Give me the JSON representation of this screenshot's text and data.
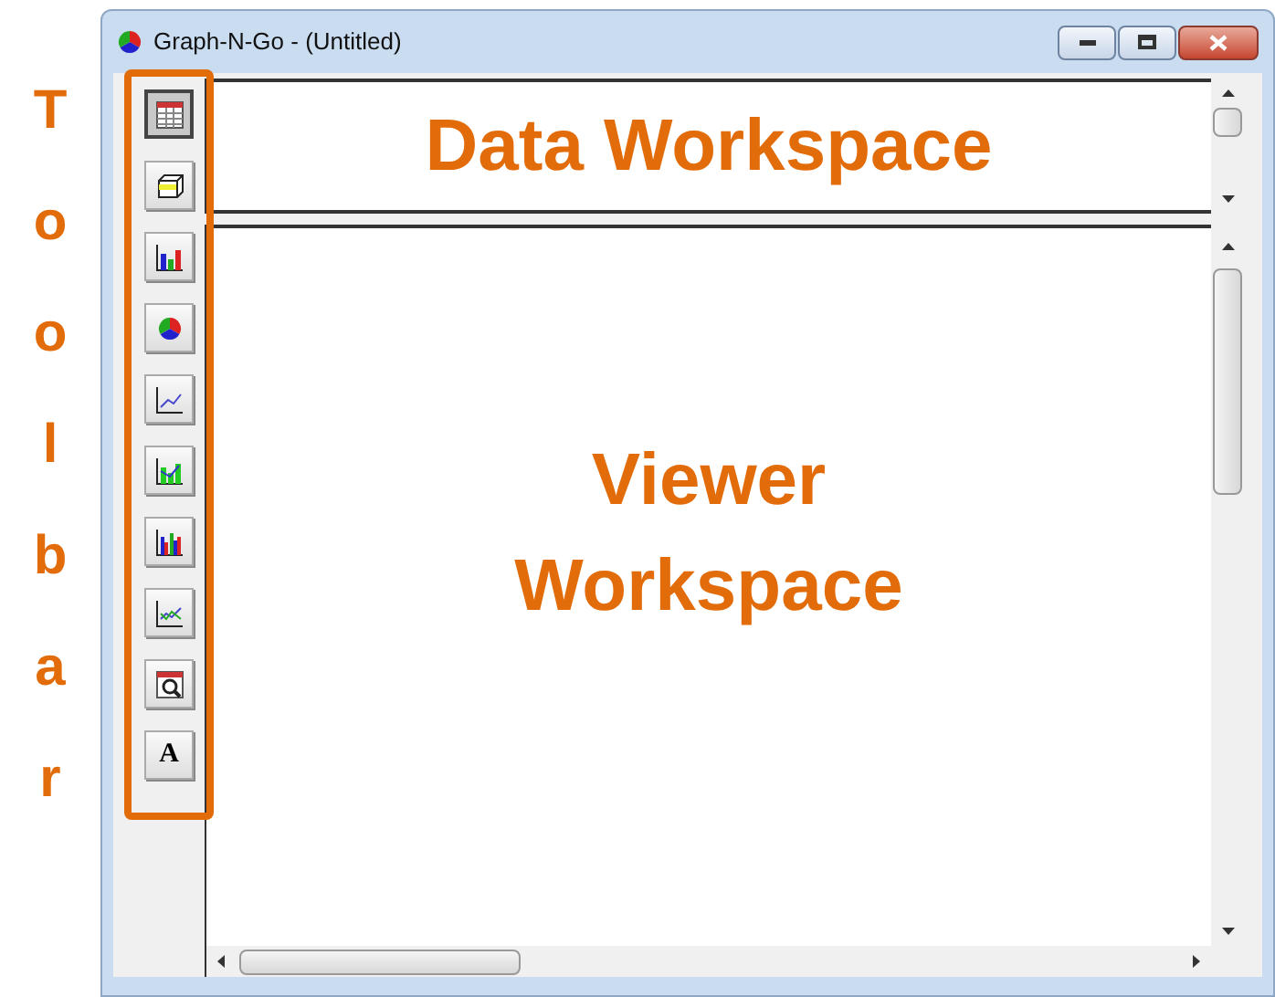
{
  "annotation": {
    "toolbar_label": "Toolbar"
  },
  "window": {
    "title": "Graph-N-Go - (Untitled)"
  },
  "toolbar": [
    {
      "kind": "table",
      "selected": true
    },
    {
      "kind": "box",
      "selected": false
    },
    {
      "kind": "bar",
      "selected": false
    },
    {
      "kind": "pie",
      "selected": false
    },
    {
      "kind": "line",
      "selected": false
    },
    {
      "kind": "area",
      "selected": false
    },
    {
      "kind": "multibar",
      "selected": false
    },
    {
      "kind": "multiline",
      "selected": false
    },
    {
      "kind": "zoom",
      "selected": false
    },
    {
      "kind": "text",
      "label": "A",
      "selected": false
    }
  ],
  "data_workspace": {
    "label": "Data Workspace"
  },
  "viewer_workspace": {
    "label": "Viewer Workspace"
  }
}
